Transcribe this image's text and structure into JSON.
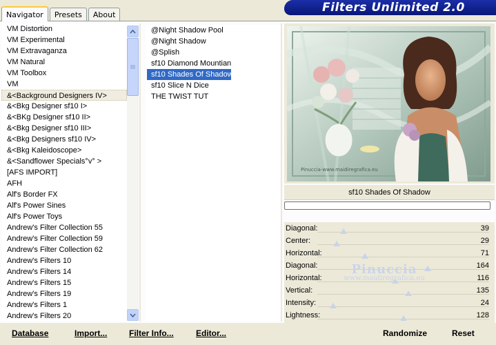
{
  "tabs": [
    "Navigator",
    "Presets",
    "About"
  ],
  "banner_title": "Filters Unlimited 2.0",
  "categories": [
    "VM Distortion",
    "VM Experimental",
    "VM Extravaganza",
    "VM Natural",
    "VM Toolbox",
    "VM",
    "&<Background Designers IV>",
    "&<Bkg Designer sf10 I>",
    "&<BKg Designer sf10 II>",
    "&<Bkg Designer sf10 III>",
    "&<Bkg Designers sf10 IV>",
    "&<Bkg Kaleidoscope>",
    "&<Sandflower Specials°v° >",
    "[AFS IMPORT]",
    "AFH",
    "Alf's Border FX",
    "Alf's Power Sines",
    "Alf's Power Toys",
    "Andrew's Filter Collection 55",
    "Andrew's Filter Collection 59",
    "Andrew's Filter Collection 62",
    "Andrew's Filters 10",
    "Andrew's Filters 14",
    "Andrew's Filters 15",
    "Andrew's Filters 19",
    "Andrew's Filters 1",
    "Andrew's Filters 20"
  ],
  "selected_category": "&<Background Designers IV>",
  "filters": [
    "@Night Shadow Pool",
    "@Night Shadow",
    "@Splish",
    "sf10 Diamond Mountian",
    "sf10 Shades Of Shadow",
    "sf10 Slice N Dice",
    "THE TWIST TUT"
  ],
  "selected_filter": "sf10 Shades Of Shadow",
  "preview": {
    "filter_name": "sf10 Shades Of Shadow",
    "progress": 0
  },
  "preview_image_caption": "Pinuccia-www.maidiregrafica.eu",
  "sliders": [
    {
      "label": "Diagonal:",
      "value": "39"
    },
    {
      "label": "Center:",
      "value": "29"
    },
    {
      "label": "Horizontal:",
      "value": "71"
    },
    {
      "label": "Diagonal:",
      "value": "164"
    },
    {
      "label": "Horizontal:",
      "value": "116"
    },
    {
      "label": "Vertical:",
      "value": "135"
    },
    {
      "label": "Intensity:",
      "value": "24"
    },
    {
      "label": "Lightness:",
      "value": "128"
    }
  ],
  "watermark": {
    "name": "Pinuccia",
    "url": "www.maidiregrafica.eu"
  },
  "buttons": {
    "database": "Database",
    "import": "Import...",
    "filter_info": "Filter Info...",
    "editor": "Editor...",
    "randomize": "Randomize",
    "reset": "Reset"
  },
  "colors": {
    "selection": "#316ac5",
    "banner": "#0a1a8a",
    "tab_highlight": "#ffc83c"
  }
}
